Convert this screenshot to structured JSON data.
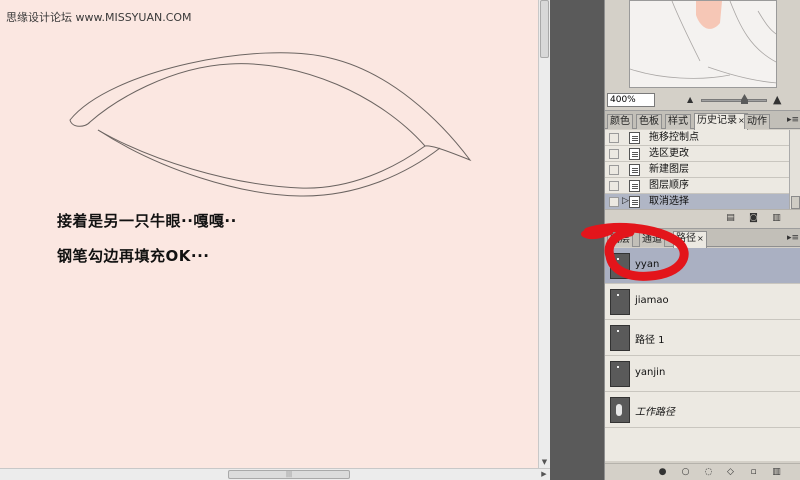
{
  "canvas": {
    "watermark": "思缘设计论坛 www.MISSYUAN.COM",
    "caption_line_1": "接着是另一只牛眼··嘎嘎··",
    "caption_line_2": "钢笔勾边再填充OK···",
    "background_color": "#fbe7e1"
  },
  "navigator": {
    "zoom_value": "400%",
    "zoom_out_icon": "small-mountain-icon",
    "zoom_in_icon": "large-mountain-icon"
  },
  "history_panel": {
    "tabs": [
      {
        "label": "颜色",
        "active": false
      },
      {
        "label": "色板",
        "active": false
      },
      {
        "label": "样式",
        "active": false
      },
      {
        "label": "历史记录",
        "active": true,
        "close": "×"
      },
      {
        "label": "动作",
        "active": false
      }
    ],
    "menu_icon": "▸≡",
    "items": [
      {
        "label": "拖移控制点",
        "selected": false
      },
      {
        "label": "选区更改",
        "selected": false
      },
      {
        "label": "新建图层",
        "selected": false
      },
      {
        "label": "图层顺序",
        "selected": false
      },
      {
        "label": "取消选择",
        "selected": true
      }
    ],
    "current_marker": "▷",
    "footer_icons": [
      "new-snapshot-icon",
      "camera-icon",
      "trash-icon"
    ]
  },
  "paths_panel": {
    "tabs": [
      {
        "label": "图层",
        "active": false
      },
      {
        "label": "通道",
        "active": false
      },
      {
        "label": "路径",
        "active": true,
        "close": "×"
      }
    ],
    "menu_icon": "▸≡",
    "paths": [
      {
        "label": "yyan",
        "selected": true,
        "italic": false
      },
      {
        "label": "jiamao",
        "selected": false,
        "italic": false
      },
      {
        "label": "路径 1",
        "selected": false,
        "italic": false
      },
      {
        "label": "yanjin",
        "selected": false,
        "italic": false
      },
      {
        "label": "工作路径",
        "selected": false,
        "italic": true
      }
    ],
    "footer_icons": [
      "fill-path-icon",
      "stroke-path-icon",
      "load-selection-icon",
      "make-workpath-icon",
      "new-path-icon",
      "trash-icon"
    ]
  },
  "annotation": {
    "highlight_color": "#e3151b"
  }
}
